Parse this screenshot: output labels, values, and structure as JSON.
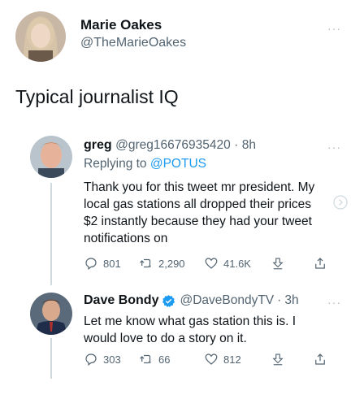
{
  "main_tweet": {
    "display_name": "Marie Oakes",
    "handle": "@TheMarieOakes",
    "text": "Typical journalist IQ"
  },
  "reply_1": {
    "display_name": "greg",
    "handle": "@greg16676935420",
    "separator": "·",
    "time": "8h",
    "replying_prefix": "Replying to",
    "replying_to": "@POTUS",
    "text": "Thank you for this tweet mr president. My local gas stations all dropped their prices $2 instantly because they had your tweet notifications on",
    "stats": {
      "replies": "801",
      "retweets": "2,290",
      "likes": "41.6K"
    }
  },
  "reply_2": {
    "display_name": "Dave Bondy",
    "verified": true,
    "handle": "@DaveBondyTV",
    "separator": "·",
    "time": "3h",
    "text": "Let me know what gas station this is. I would love to do a story on it.",
    "stats": {
      "replies": "303",
      "retweets": "66",
      "likes": "812"
    }
  },
  "more_label": "···",
  "colors": {
    "accent": "#1d9bf0",
    "muted": "#536471",
    "thread_line": "#cfd9de",
    "text": "#0f1419"
  }
}
